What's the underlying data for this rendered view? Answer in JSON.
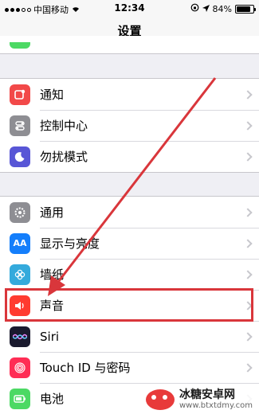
{
  "status": {
    "carrier": "中国移动",
    "time": "12:34",
    "battery": "84%",
    "battery_level": 0.84
  },
  "nav": {
    "title": "设置"
  },
  "groups": [
    [
      {
        "label": "通知",
        "icon": "notifications-icon",
        "color": "#f24949"
      },
      {
        "label": "控制中心",
        "icon": "control-center-icon",
        "color": "#8e8e93"
      },
      {
        "label": "勿扰模式",
        "icon": "moon-icon",
        "color": "#5856d6"
      }
    ],
    [
      {
        "label": "通用",
        "icon": "gear-icon",
        "color": "#8e8e93"
      },
      {
        "label": "显示与亮度",
        "icon": "display-brightness-icon",
        "color": "#147efb"
      },
      {
        "label": "墙纸",
        "icon": "wallpaper-icon",
        "color": "#34aadc"
      },
      {
        "label": "声音",
        "icon": "sound-icon",
        "color": "#ff3b30"
      },
      {
        "label": "Siri",
        "icon": "siri-icon",
        "color": "#1a1a2e"
      },
      {
        "label": "Touch ID 与密码",
        "icon": "fingerprint-icon",
        "color": "#ff2d55"
      },
      {
        "label": "电池",
        "icon": "battery-icon",
        "color": "#4cd964"
      }
    ]
  ],
  "watermark": {
    "title": "冰糖安卓网",
    "url": "www.btxtdmy.com"
  },
  "accent_color": "#d9363b"
}
